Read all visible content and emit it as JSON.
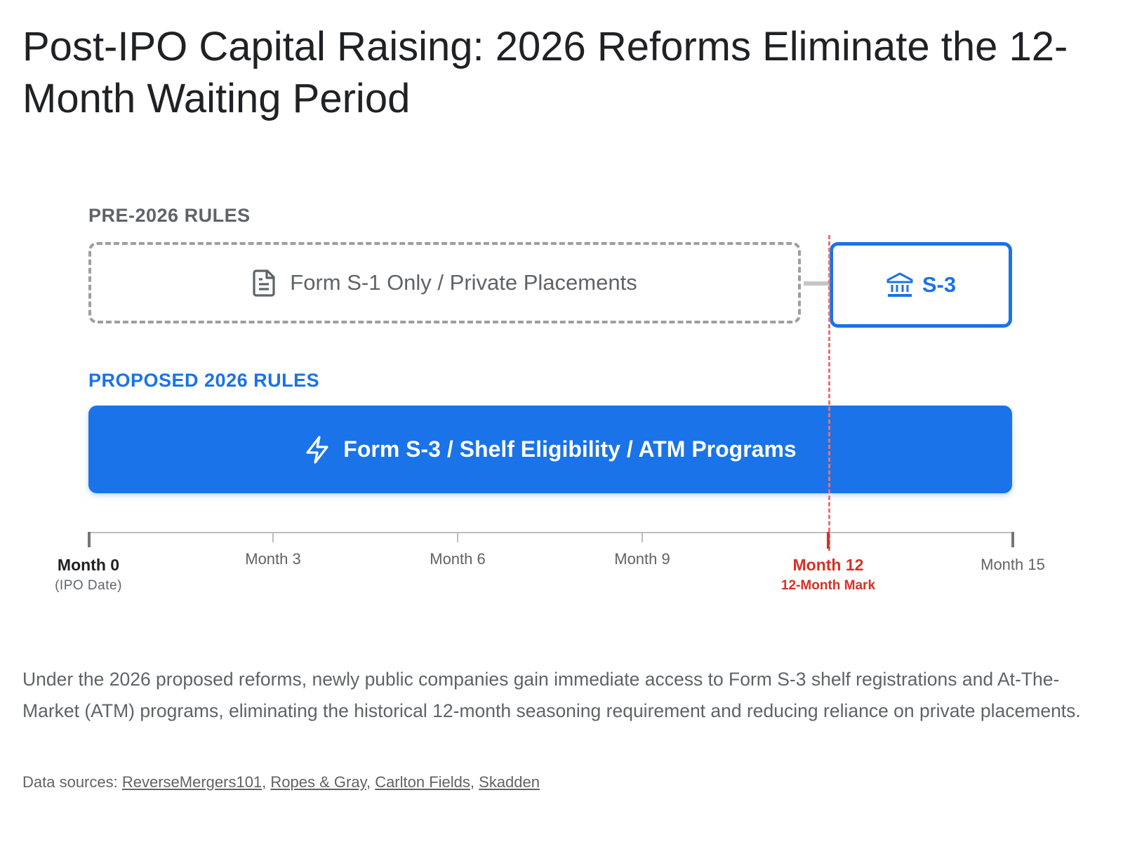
{
  "title": "Post-IPO Capital Raising: 2026 Reforms Eliminate the 12-Month Waiting Period",
  "lanes": {
    "pre": {
      "label": "PRE-2026 RULES",
      "box_text": "Form S-1 Only / Private Placements",
      "box_icon": "document-icon",
      "s3_text": "S-3",
      "s3_icon": "bank-icon"
    },
    "proposed": {
      "label": "PROPOSED 2026 RULES",
      "bar_text": "Form S-3 / Shelf Eligibility / ATM Programs",
      "bar_icon": "lightning-icon"
    }
  },
  "timeline": {
    "ticks": [
      {
        "label": "Month 0",
        "sub": "(IPO Date)"
      },
      {
        "label": "Month 3"
      },
      {
        "label": "Month 6"
      },
      {
        "label": "Month 9"
      },
      {
        "label": "Month 12",
        "sub": "12-Month Mark"
      },
      {
        "label": "Month 15"
      }
    ]
  },
  "summary": "Under the 2026 proposed reforms, newly public companies gain immediate access to Form S-3 shelf registrations and At-The-Market (ATM) programs, eliminating the historical 12-month seasoning requirement and reducing reliance on private placements.",
  "sources": {
    "prefix": "Data sources:",
    "links": [
      "ReverseMergers101",
      "Ropes & Gray",
      "Carlton Fields",
      "Skadden"
    ]
  },
  "colors": {
    "accent": "#1a73e8",
    "marker": "#d93025",
    "muted": "#5f6368"
  }
}
